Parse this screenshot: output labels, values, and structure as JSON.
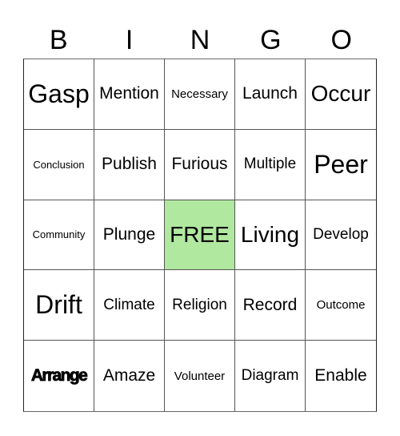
{
  "card": {
    "header": [
      "B",
      "I",
      "N",
      "G",
      "O"
    ],
    "free_color": "#b0e8a0",
    "rows": [
      [
        {
          "text": "Gasp",
          "size": "xl"
        },
        {
          "text": "Mention",
          "size": "md"
        },
        {
          "text": "Necessary",
          "size": "xs"
        },
        {
          "text": "Launch",
          "size": "md"
        },
        {
          "text": "Occur",
          "size": "lg"
        }
      ],
      [
        {
          "text": "Conclusion",
          "size": "xxs"
        },
        {
          "text": "Publish",
          "size": "md"
        },
        {
          "text": "Furious",
          "size": "md"
        },
        {
          "text": "Multiple",
          "size": "sm"
        },
        {
          "text": "Peer",
          "size": "xl"
        }
      ],
      [
        {
          "text": "Community",
          "size": "xxs"
        },
        {
          "text": "Plunge",
          "size": "md"
        },
        {
          "text": "FREE",
          "size": "lg",
          "free": true
        },
        {
          "text": "Living",
          "size": "lg"
        },
        {
          "text": "Develop",
          "size": "sm"
        }
      ],
      [
        {
          "text": "Drift",
          "size": "xl"
        },
        {
          "text": "Climate",
          "size": "sm"
        },
        {
          "text": "Religion",
          "size": "sm"
        },
        {
          "text": "Record",
          "size": "md"
        },
        {
          "text": "Outcome",
          "size": "xs"
        }
      ],
      [
        {
          "text": "Arrange",
          "size": "heavy"
        },
        {
          "text": "Amaze",
          "size": "md"
        },
        {
          "text": "Volunteer",
          "size": "xs"
        },
        {
          "text": "Diagram",
          "size": "sm"
        },
        {
          "text": "Enable",
          "size": "md"
        }
      ]
    ]
  }
}
